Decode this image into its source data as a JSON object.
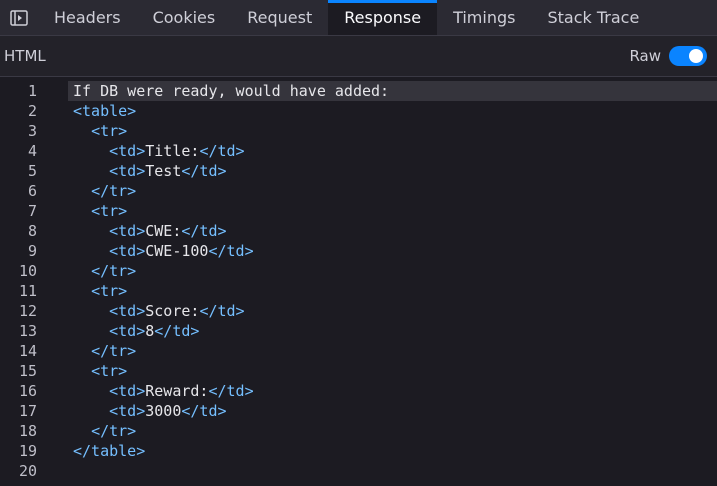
{
  "tabs": [
    "Headers",
    "Cookies",
    "Request",
    "Response",
    "Timings",
    "Stack Trace"
  ],
  "active_tab": "Response",
  "toolbar": {
    "format_label": "HTML",
    "raw_label": "Raw",
    "raw_enabled": true
  },
  "lines": [
    [
      [
        "txt",
        "If DB were ready, would have added:"
      ]
    ],
    [
      [
        "tag",
        "<table>"
      ]
    ],
    [
      [
        "txt",
        "  "
      ],
      [
        "tag",
        "<tr>"
      ]
    ],
    [
      [
        "txt",
        "    "
      ],
      [
        "tag",
        "<td>"
      ],
      [
        "txt",
        "Title:"
      ],
      [
        "tag",
        "</td>"
      ]
    ],
    [
      [
        "txt",
        "    "
      ],
      [
        "tag",
        "<td>"
      ],
      [
        "txt",
        "Test"
      ],
      [
        "tag",
        "</td>"
      ]
    ],
    [
      [
        "txt",
        "  "
      ],
      [
        "tag",
        "</tr>"
      ]
    ],
    [
      [
        "txt",
        "  "
      ],
      [
        "tag",
        "<tr>"
      ]
    ],
    [
      [
        "txt",
        "    "
      ],
      [
        "tag",
        "<td>"
      ],
      [
        "txt",
        "CWE:"
      ],
      [
        "tag",
        "</td>"
      ]
    ],
    [
      [
        "txt",
        "    "
      ],
      [
        "tag",
        "<td>"
      ],
      [
        "txt",
        "CWE-100"
      ],
      [
        "tag",
        "</td>"
      ]
    ],
    [
      [
        "txt",
        "  "
      ],
      [
        "tag",
        "</tr>"
      ]
    ],
    [
      [
        "txt",
        "  "
      ],
      [
        "tag",
        "<tr>"
      ]
    ],
    [
      [
        "txt",
        "    "
      ],
      [
        "tag",
        "<td>"
      ],
      [
        "txt",
        "Score:"
      ],
      [
        "tag",
        "</td>"
      ]
    ],
    [
      [
        "txt",
        "    "
      ],
      [
        "tag",
        "<td>"
      ],
      [
        "txt",
        "8"
      ],
      [
        "tag",
        "</td>"
      ]
    ],
    [
      [
        "txt",
        "  "
      ],
      [
        "tag",
        "</tr>"
      ]
    ],
    [
      [
        "txt",
        "  "
      ],
      [
        "tag",
        "<tr>"
      ]
    ],
    [
      [
        "txt",
        "    "
      ],
      [
        "tag",
        "<td>"
      ],
      [
        "txt",
        "Reward:"
      ],
      [
        "tag",
        "</td>"
      ]
    ],
    [
      [
        "txt",
        "    "
      ],
      [
        "tag",
        "<td>"
      ],
      [
        "txt",
        "3000"
      ],
      [
        "tag",
        "</td>"
      ]
    ],
    [
      [
        "txt",
        "  "
      ],
      [
        "tag",
        "</tr>"
      ]
    ],
    [
      [
        "tag",
        "</table>"
      ]
    ],
    []
  ],
  "current_line": 1,
  "colors": {
    "accent": "#0a84ff",
    "tag": "#75bfff",
    "background": "#1c1b22"
  }
}
